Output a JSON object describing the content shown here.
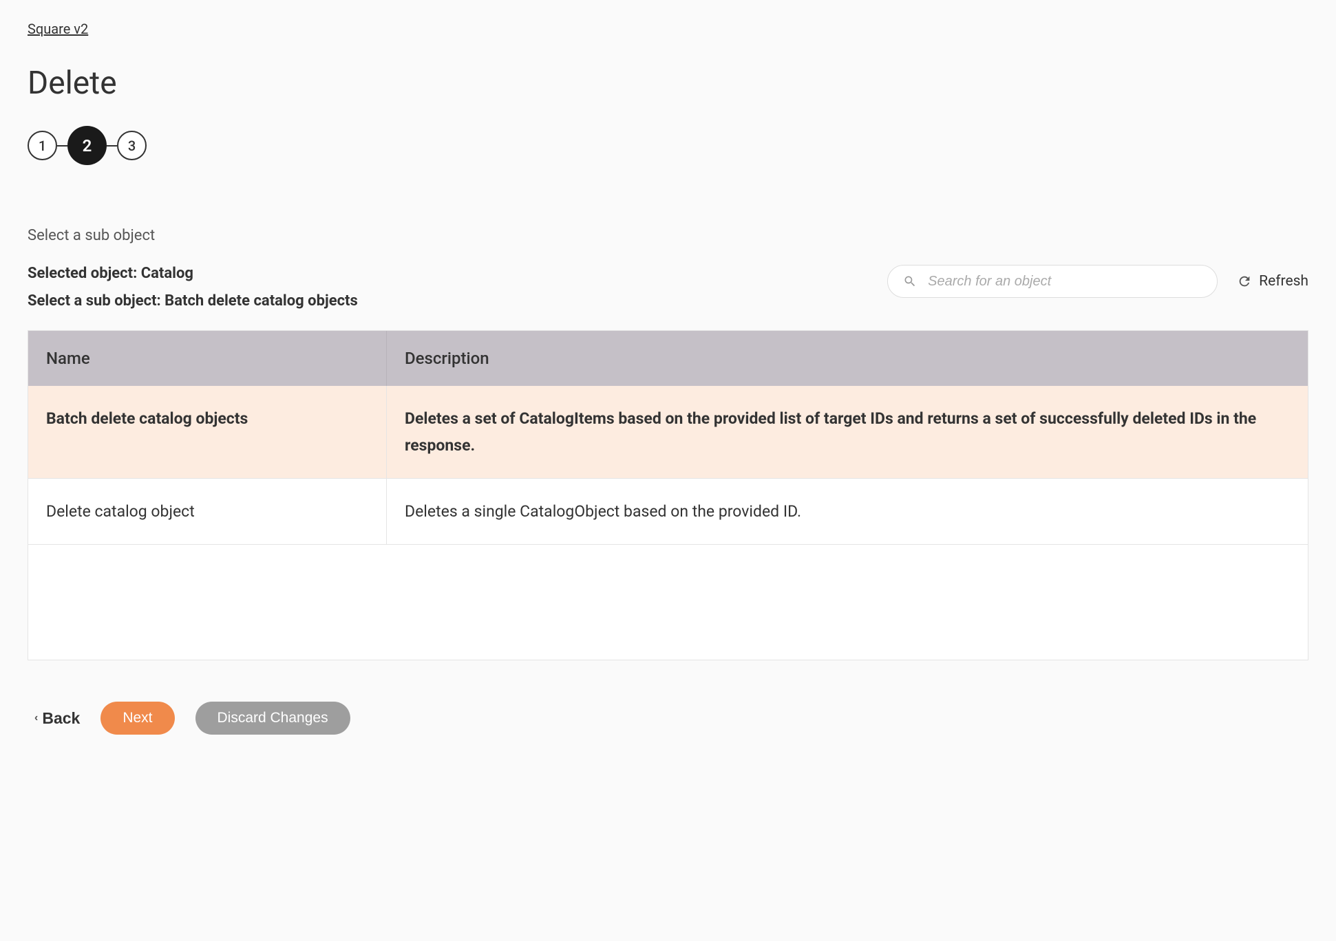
{
  "breadcrumb": "Square v2",
  "page_title": "Delete",
  "stepper": {
    "steps": [
      "1",
      "2",
      "3"
    ],
    "active_index": 1
  },
  "section_label": "Select a sub object",
  "selected_object_line": "Selected object: Catalog",
  "select_sub_line": "Select a sub object: Batch delete catalog objects",
  "search": {
    "placeholder": "Search for an object",
    "value": ""
  },
  "refresh_label": "Refresh",
  "table": {
    "headers": {
      "name": "Name",
      "description": "Description"
    },
    "rows": [
      {
        "name": "Batch delete catalog objects",
        "description": "Deletes a set of CatalogItems based on the provided list of target IDs and returns a set of successfully deleted IDs in the response.",
        "selected": true
      },
      {
        "name": "Delete catalog object",
        "description": "Deletes a single CatalogObject based on the provided ID.",
        "selected": false
      }
    ]
  },
  "buttons": {
    "back": "Back",
    "next": "Next",
    "discard": "Discard Changes"
  }
}
